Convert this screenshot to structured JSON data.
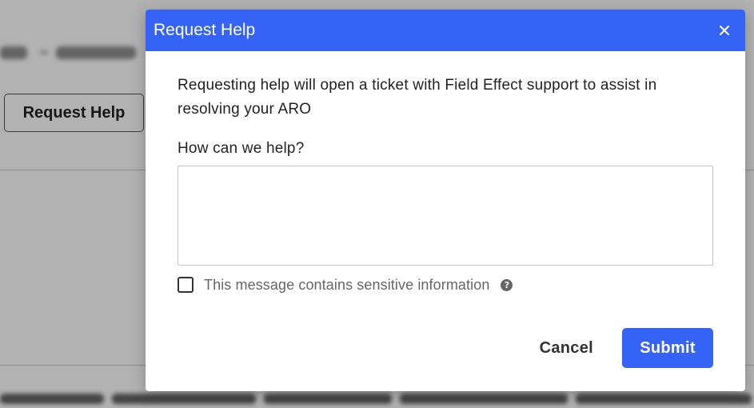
{
  "background": {
    "request_help_label": "Request Help"
  },
  "modal": {
    "title": "Request Help",
    "close_icon": "close-icon",
    "intro_text": "Requesting help will open a ticket with Field Effect support to assist in resolving your ARO",
    "field_label": "How can we help?",
    "textarea_value": "",
    "sensitive_checkbox_label": "This message contains sensitive information",
    "sensitive_checked": false,
    "help_icon": "question-circle-icon",
    "cancel_label": "Cancel",
    "submit_label": "Submit"
  },
  "colors": {
    "accent": "#3563f5",
    "overlay": "rgba(0,0,0,0.30)"
  }
}
